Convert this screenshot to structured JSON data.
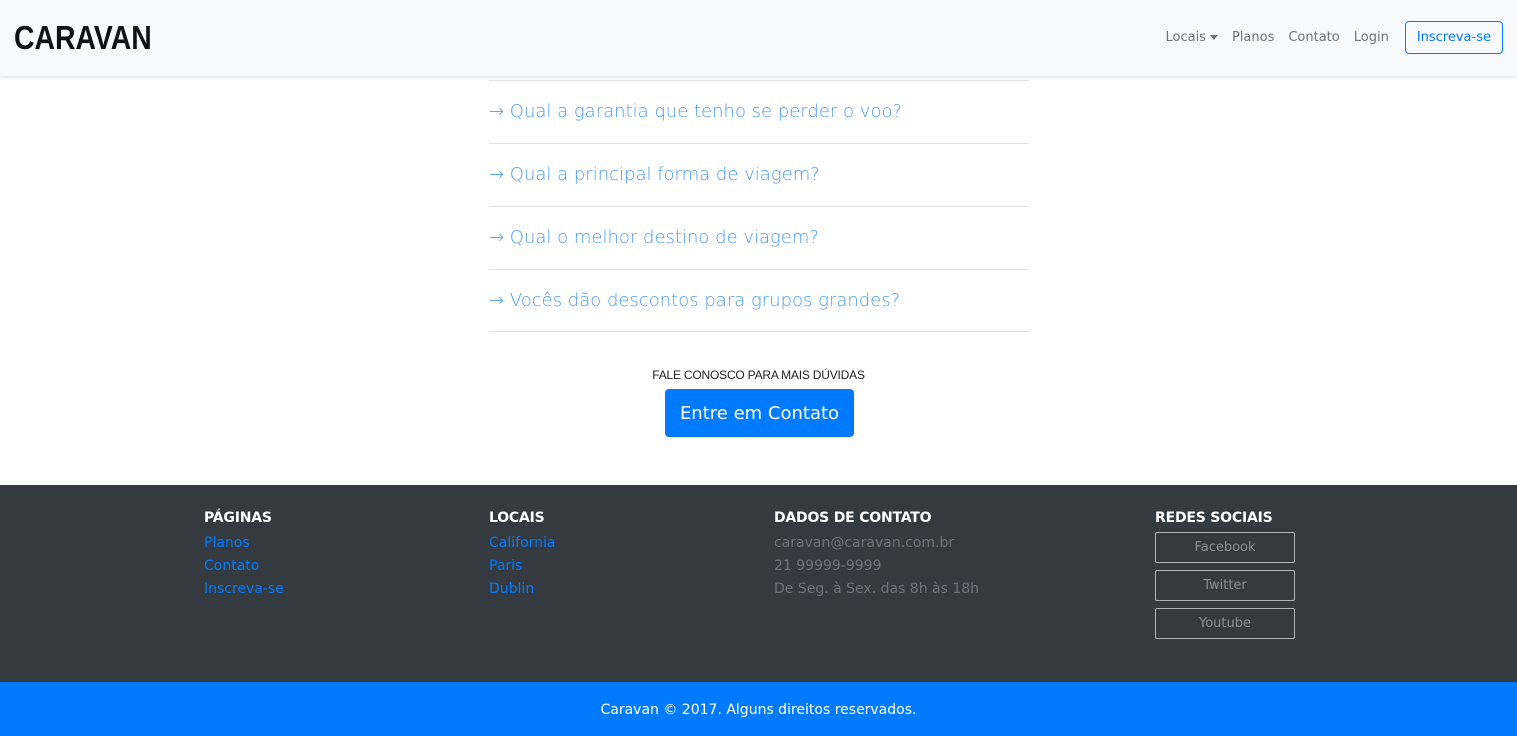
{
  "navbar": {
    "brand": "CARAVAN",
    "links": {
      "locais": "Locais",
      "planos": "Planos",
      "contato": "Contato",
      "login": "Login"
    },
    "signup": "Inscreva-se"
  },
  "faq": {
    "items": [
      "→ Qual a garantia que tenho se perder o voo?",
      "→ Qual a principal forma de viagem?",
      "→ Qual o melhor destino de viagem?",
      "→ Vocês dão descontos para grupos grandes?"
    ]
  },
  "cta": {
    "text": "FALE CONOSCO PARA MAIS DÚVIDAS",
    "button": "Entre em Contato"
  },
  "footer": {
    "pages": {
      "title": "PÁGINAS",
      "links": [
        "Planos",
        "Contato",
        "Inscreva-se"
      ]
    },
    "locations": {
      "title": "LOCAIS",
      "links": [
        "California",
        "Paris",
        "Dublin"
      ]
    },
    "contact": {
      "title": "DADOS DE CONTATO",
      "lines": [
        "caravan@caravan.com.br",
        "21 99999-9999",
        "De Seg. à Sex. das 8h às 18h"
      ]
    },
    "social": {
      "title": "REDES SOCIAIS",
      "buttons": [
        "Facebook",
        "Twitter",
        "Youtube"
      ]
    }
  },
  "copyright": "Caravan © 2017. Alguns direitos reservados.",
  "colors": {
    "primary": "#007bff",
    "footer_bg": "#343a40",
    "link": "#4a9ded"
  }
}
